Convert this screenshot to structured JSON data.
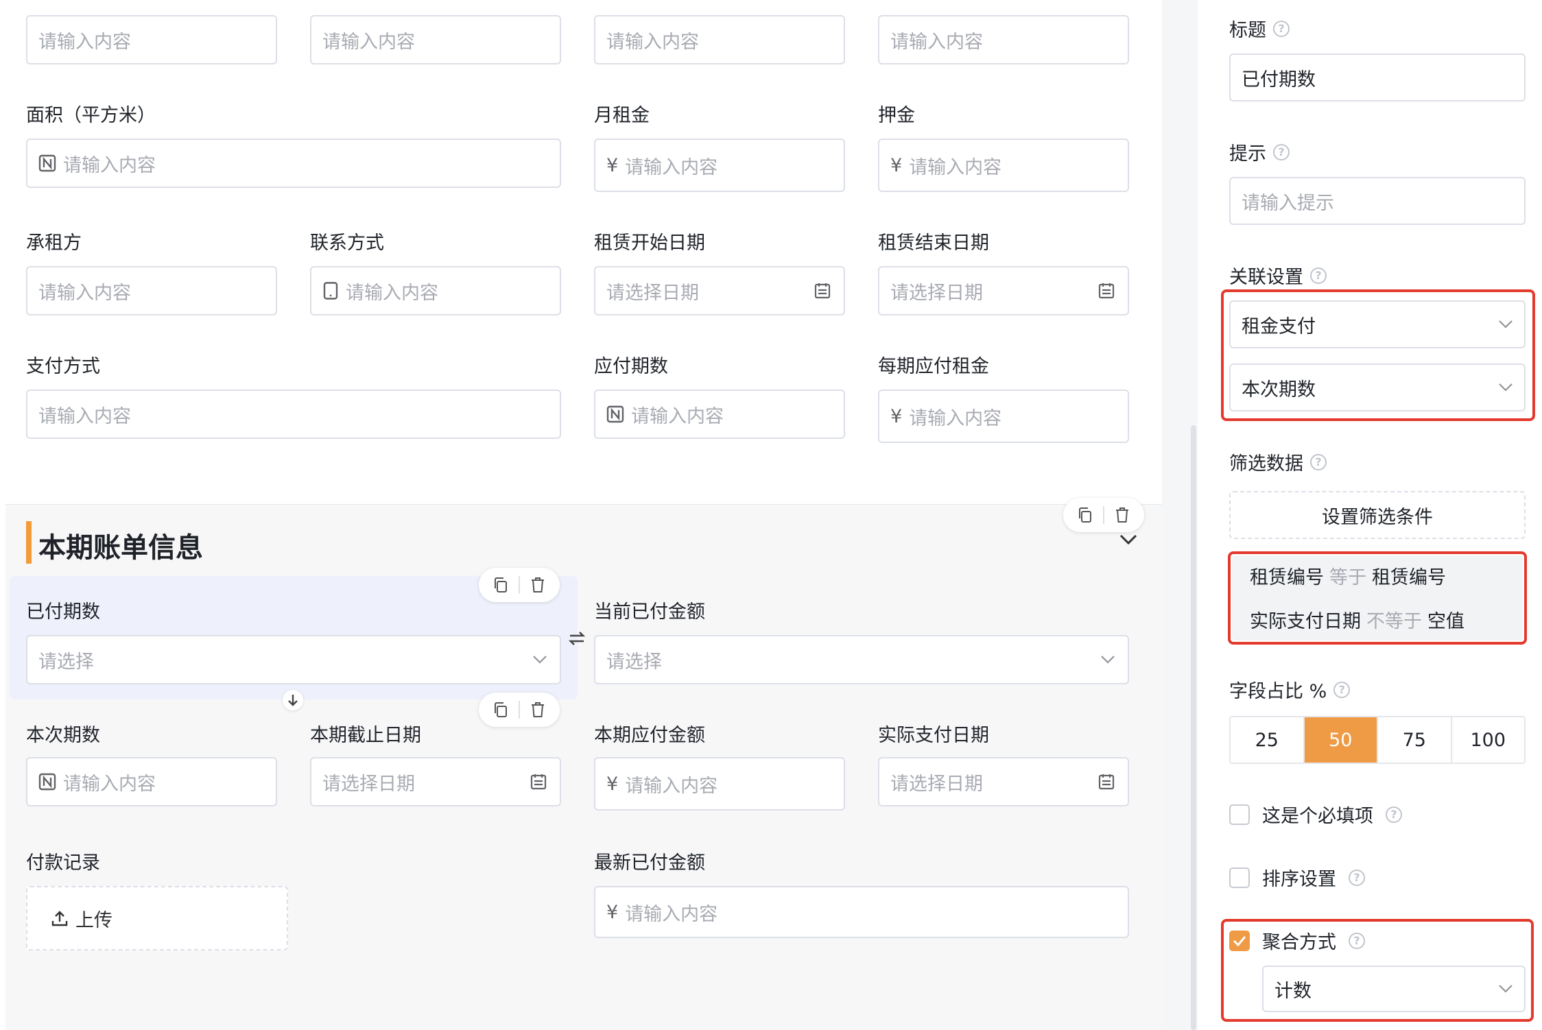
{
  "form": {
    "top_inputs": [
      "请输入内容",
      "请输入内容",
      "请输入内容",
      "请输入内容"
    ],
    "area": {
      "label": "面积（平方米）",
      "placeholder": "请输入内容"
    },
    "monthly_rent": {
      "label": "月租金",
      "prefix": "¥",
      "placeholder": "请输入内容"
    },
    "deposit": {
      "label": "押金",
      "prefix": "¥",
      "placeholder": "请输入内容"
    },
    "tenant": {
      "label": "承租方",
      "placeholder": "请输入内容"
    },
    "contact": {
      "label": "联系方式",
      "placeholder": "请输入内容"
    },
    "lease_start": {
      "label": "租赁开始日期",
      "placeholder": "请选择日期"
    },
    "lease_end": {
      "label": "租赁结束日期",
      "placeholder": "请选择日期"
    },
    "payment_method": {
      "label": "支付方式",
      "placeholder": "请输入内容"
    },
    "periods_due": {
      "label": "应付期数",
      "placeholder": "请输入内容"
    },
    "rent_per_period": {
      "label": "每期应付租金",
      "prefix": "¥",
      "placeholder": "请输入内容"
    }
  },
  "section": {
    "title": "本期账单信息",
    "paid_periods": {
      "label": "已付期数",
      "placeholder": "请选择"
    },
    "current_paid_amount": {
      "label": "当前已付金额",
      "placeholder": "请选择"
    },
    "this_period_no": {
      "label": "本次期数",
      "placeholder": "请输入内容"
    },
    "period_deadline": {
      "label": "本期截止日期",
      "placeholder": "请选择日期"
    },
    "period_amount_due": {
      "label": "本期应付金额",
      "prefix": "¥",
      "placeholder": "请输入内容"
    },
    "actual_pay_date": {
      "label": "实际支付日期",
      "placeholder": "请选择日期"
    },
    "payment_record": {
      "label": "付款记录",
      "upload_label": "上传"
    },
    "latest_paid_amount": {
      "label": "最新已付金额",
      "prefix": "¥",
      "placeholder": "请输入内容"
    }
  },
  "panel": {
    "title_label": "标题",
    "title_value": "已付期数",
    "hint_label": "提示",
    "hint_placeholder": "请输入提示",
    "link_label": "关联设置",
    "link_form": "租金支付",
    "link_field": "本次期数",
    "filter_label": "筛选数据",
    "filter_button": "设置筛选条件",
    "conditions": [
      {
        "field": "租赁编号",
        "op": "等于",
        "value": "租赁编号"
      },
      {
        "field": "实际支付日期",
        "op": "不等于",
        "value": "空值"
      }
    ],
    "width_label": "字段占比 %",
    "width_options": [
      "25",
      "50",
      "75",
      "100"
    ],
    "width_selected": "50",
    "required_label": "这是个必填项",
    "sort_label": "排序设置",
    "aggregate_label": "聚合方式",
    "aggregate_value": "计数",
    "accent_color": "#ef9a44",
    "highlight_color": "#e33a2d"
  },
  "help_glyph": "?"
}
